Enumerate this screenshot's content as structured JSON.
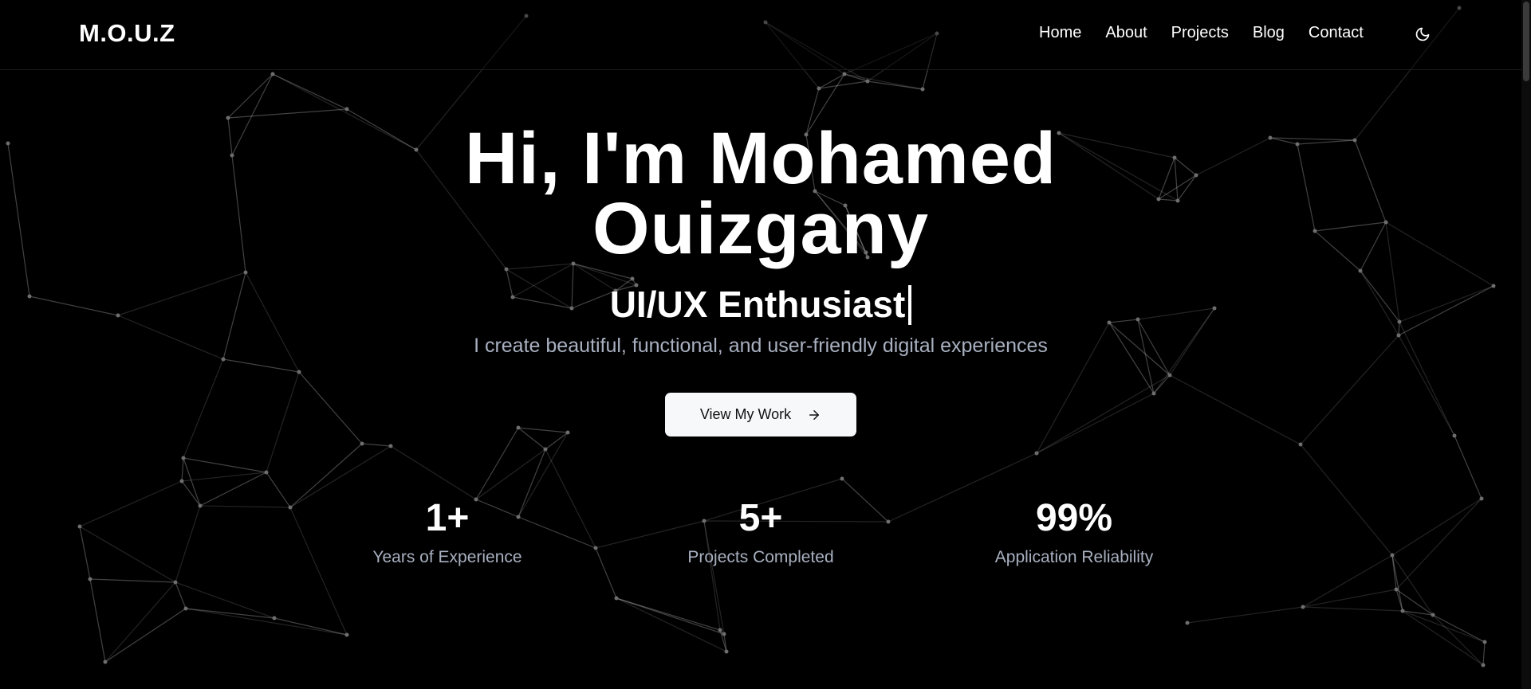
{
  "header": {
    "logo": "M.O.U.Z",
    "nav": [
      {
        "label": "Home"
      },
      {
        "label": "About"
      },
      {
        "label": "Projects"
      },
      {
        "label": "Blog"
      },
      {
        "label": "Contact"
      }
    ],
    "theme_toggle_icon": "moon-icon"
  },
  "hero": {
    "title_line1": "Hi, I'm Mohamed",
    "title_line2": "Ouizgany",
    "role": "UI/UX Enthusiast",
    "description": "I create beautiful, functional, and user-friendly digital experiences",
    "cta_label": "View My Work",
    "cta_icon": "arrow-right-icon"
  },
  "stats": [
    {
      "value": "1+",
      "label": "Years of Experience"
    },
    {
      "value": "5+",
      "label": "Projects Completed"
    },
    {
      "value": "99%",
      "label": "Application Reliability"
    }
  ],
  "colors": {
    "background": "#000000",
    "text_primary": "#ffffff",
    "text_muted": "#a8b0c0",
    "button_bg": "#f7f8fa"
  }
}
